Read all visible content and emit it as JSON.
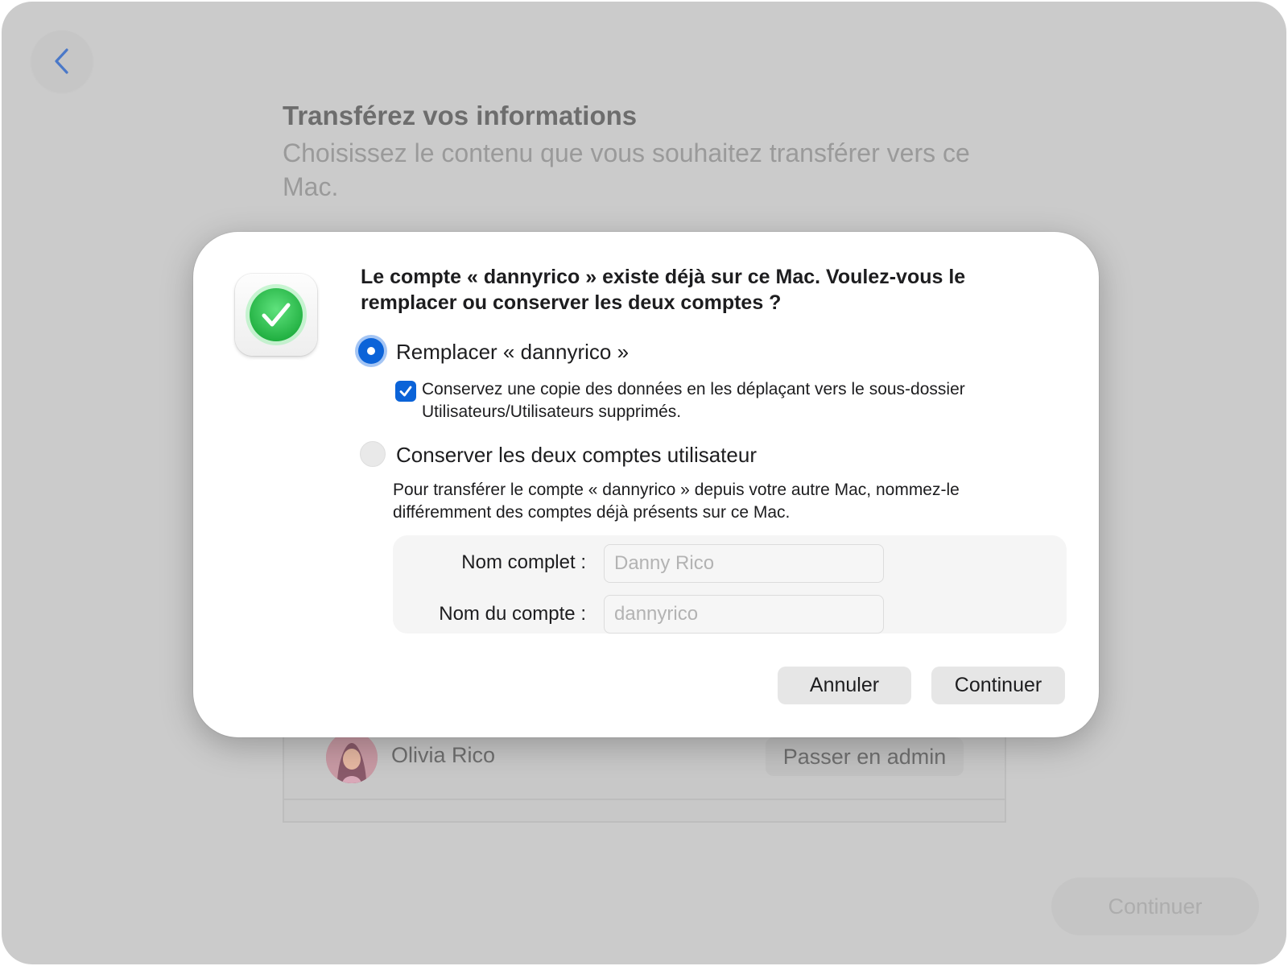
{
  "background": {
    "title": "Transférez vos informations",
    "subtitle": "Choisissez le contenu que vous souhaitez transférer vers ce Mac.",
    "user_row": {
      "name": "Olivia Rico",
      "action_label": "Passer en admin"
    },
    "continue_label": "Continuer"
  },
  "dialog": {
    "message": "Le compte « dannyrico » existe déjà sur ce Mac. Voulez-vous le remplacer ou conserver les deux comptes ?",
    "option_replace": {
      "label": "Remplacer « dannyrico »",
      "selected": true,
      "checkbox_label": "Conservez une copie des données en les déplaçant vers le sous-dossier Utilisateurs/Utilisateurs supprimés.",
      "checkbox_checked": true
    },
    "option_keep_both": {
      "label": "Conserver les deux comptes utilisateur",
      "selected": false,
      "help_text": "Pour transférer le compte « dannyrico » depuis votre autre Mac, nommez-le différemment des comptes déjà présents sur ce Mac."
    },
    "form": {
      "full_name_label": "Nom complet :",
      "full_name_placeholder": "Danny Rico",
      "account_name_label": "Nom du compte :",
      "account_name_placeholder": "dannyrico"
    },
    "cancel_label": "Annuler",
    "continue_label": "Continuer"
  },
  "colors": {
    "accent": "#0B63D8",
    "dimmed_background": "#CBCBCB",
    "success_green": "#34C759"
  },
  "icons": {
    "back": "chevron-left-icon",
    "app": "green-checkmark-icon",
    "checkbox": "checkmark-icon"
  }
}
